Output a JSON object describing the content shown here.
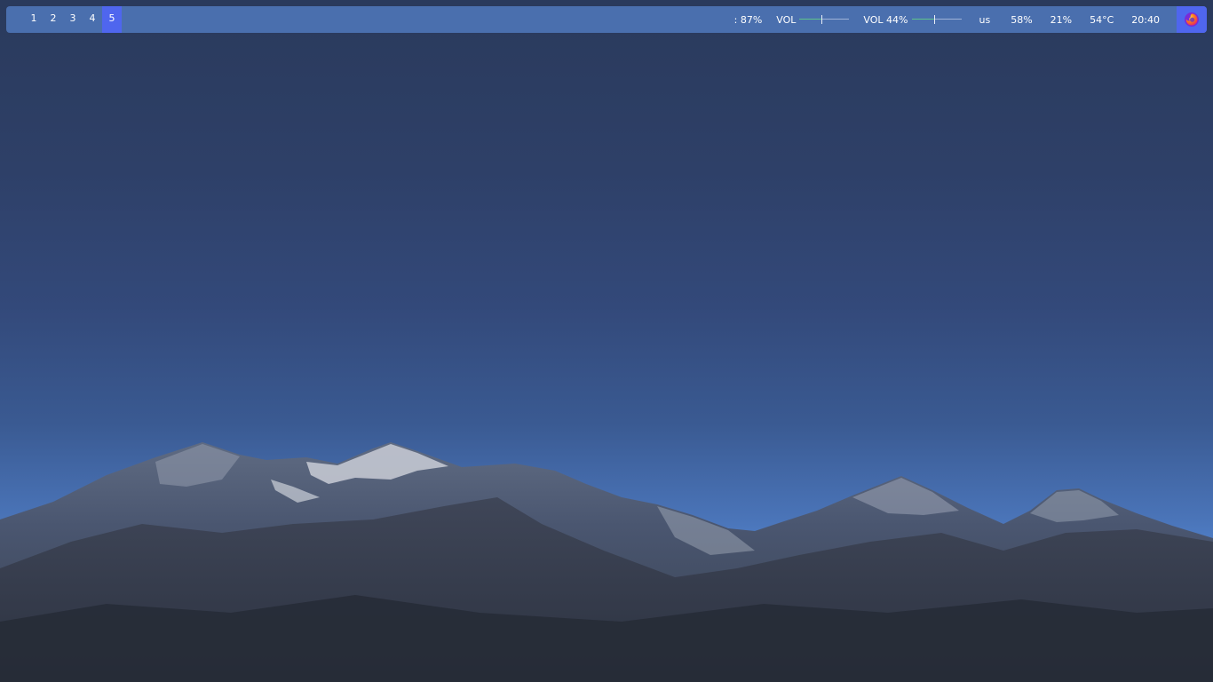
{
  "workspaces": [
    {
      "label": "1",
      "active": false
    },
    {
      "label": "2",
      "active": false
    },
    {
      "label": "3",
      "active": false
    },
    {
      "label": "4",
      "active": false
    },
    {
      "label": "5",
      "active": true
    }
  ],
  "tray": {
    "battery": ": 87%",
    "volume1_label": "VOL",
    "volume1_level": 0.44,
    "volume2_label": "VOL 44%",
    "volume2_level": 0.44,
    "keyboard_layout": "us",
    "memory": "58%",
    "cpu": "21%",
    "temperature": "54°C",
    "clock": "20:40"
  },
  "launcher_icon": "firefox-icon",
  "colors": {
    "bar_background": "#4a6fae",
    "active_workspace": "#4f66ee",
    "text": "#ffffff"
  }
}
